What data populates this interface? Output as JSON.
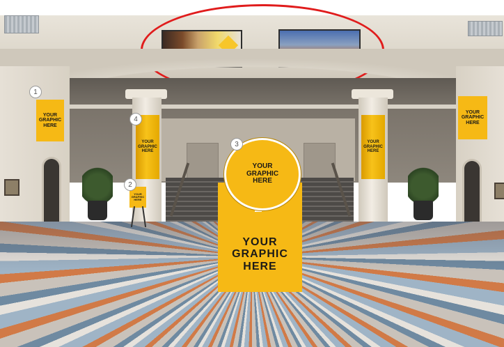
{
  "callouts": {
    "one": "1",
    "two": "2",
    "three": "3",
    "four": "4"
  },
  "graphics": {
    "left_wall_banner": "YOUR\nGRAPHIC\nHERE",
    "right_wall_banner": "YOUR\nGRAPHIC\nHERE",
    "left_column_wrap": "YOUR\nGRAPHIC\nHERE",
    "right_column_wrap": "YOUR\nGRAPHIC\nHERE",
    "easel_sign": "YOUR\nGRAPHIC\nHERE",
    "kiosk_circle": "YOUR\nGRAPHIC\nHERE",
    "kiosk_base": "YOUR\nGRAPHIC\nHERE"
  },
  "colors": {
    "sign_yellow": "#f6b915",
    "highlight_red": "#e01c1c"
  }
}
